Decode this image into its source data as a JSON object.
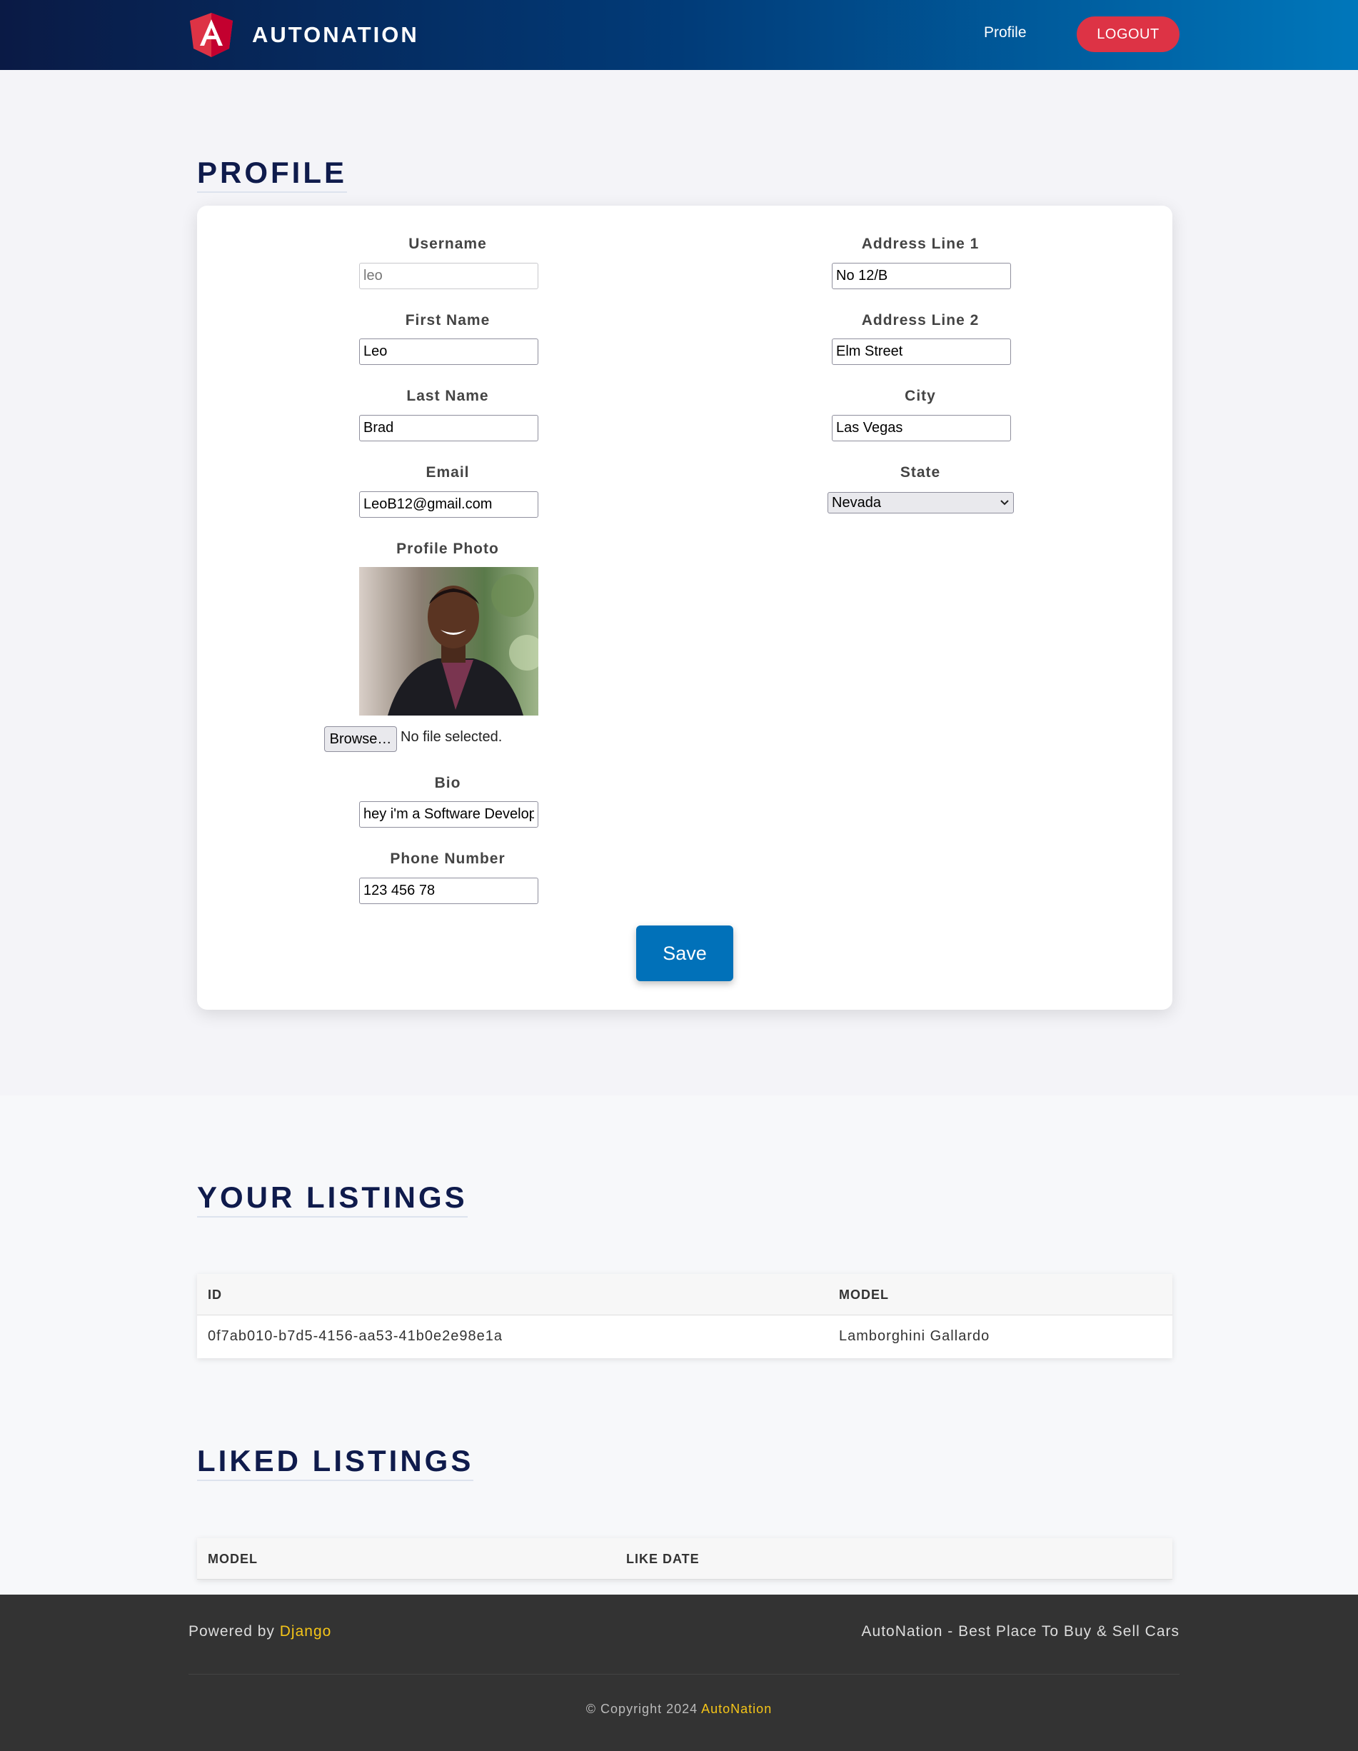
{
  "header": {
    "brand": "AUTONATION",
    "nav_profile": "Profile",
    "logout": "LOGOUT"
  },
  "profile": {
    "title": "PROFILE",
    "username_label": "Username",
    "username_value": "leo",
    "first_name_label": "First Name",
    "first_name_value": "Leo",
    "last_name_label": "Last Name",
    "last_name_value": "Brad",
    "email_label": "Email",
    "email_value": "LeoB12@gmail.com",
    "photo_label": "Profile Photo",
    "browse_label": "Browse…",
    "no_file": "No file selected.",
    "bio_label": "Bio",
    "bio_value": "hey i'm a Software Developer",
    "phone_label": "Phone Number",
    "phone_value": "123 456 78",
    "address1_label": "Address Line 1",
    "address1_value": "No 12/B",
    "address2_label": "Address Line 2",
    "address2_value": "Elm Street",
    "city_label": "City",
    "city_value": "Las Vegas",
    "state_label": "State",
    "state_value": "Nevada",
    "save": "Save"
  },
  "your_listings": {
    "title": "YOUR LISTINGS",
    "columns": [
      "ID",
      "MODEL"
    ],
    "rows": [
      {
        "id": "0f7ab010-b7d5-4156-aa53-41b0e2e98e1a",
        "model": "Lamborghini Gallardo"
      }
    ]
  },
  "liked_listings": {
    "title": "LIKED LISTINGS",
    "columns": [
      "MODEL",
      "LIKE DATE"
    ]
  },
  "footer": {
    "powered_by": "Powered by",
    "django": "Django",
    "tagline": "AutoNation - Best Place To Buy & Sell Cars",
    "copyright": "© Copyright 2024",
    "copyright_brand": "AutoNation"
  },
  "colors": {
    "header_start": "#0a1a45",
    "header_end": "#0077bb",
    "logout": "#dd3345",
    "save": "#0171b9",
    "title": "#0f1b4c",
    "footer_accent": "#f5c518"
  }
}
